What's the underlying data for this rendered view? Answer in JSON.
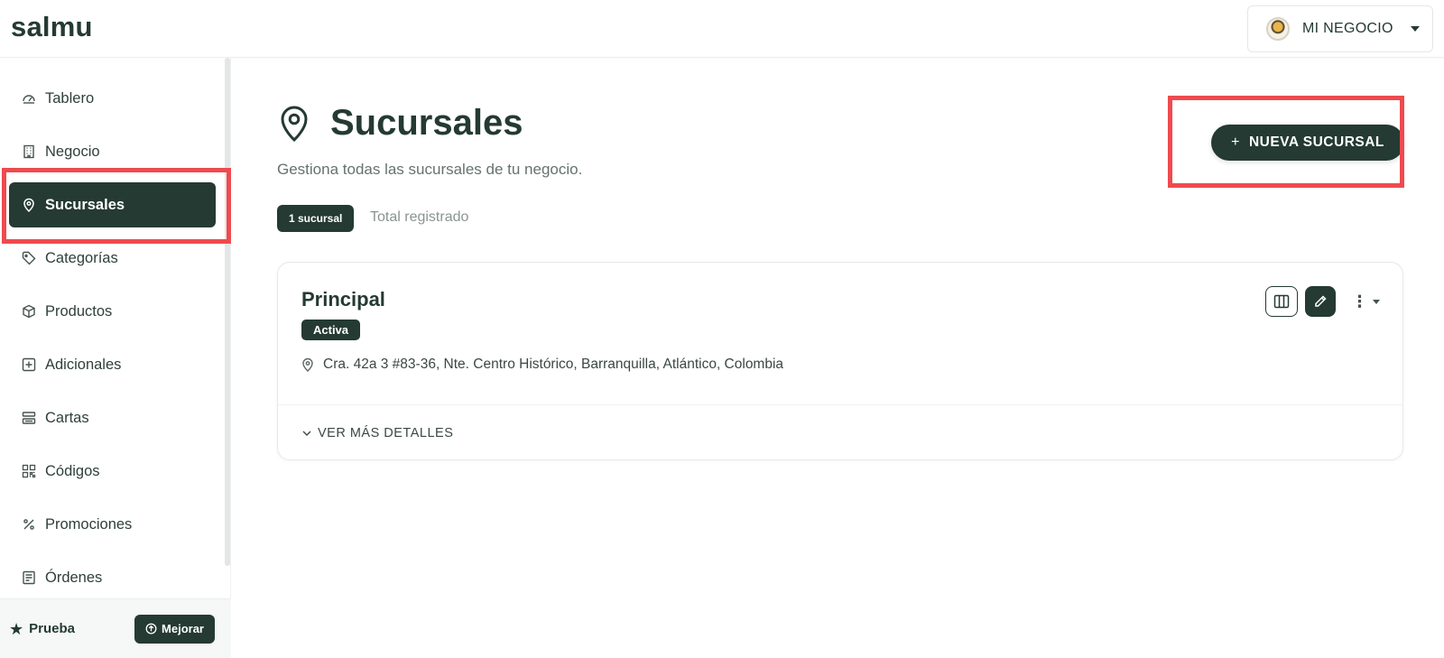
{
  "app": {
    "logo": "salmu"
  },
  "business_selector": {
    "name": "MI NEGOCIO",
    "avatar_icon": "business-logo"
  },
  "sidebar": {
    "items": [
      {
        "label": "Tablero",
        "icon": "dashboard-gauge-icon"
      },
      {
        "label": "Negocio",
        "icon": "building-icon"
      },
      {
        "label": "Sucursales",
        "icon": "map-pin-icon",
        "active": true
      },
      {
        "label": "Categorías",
        "icon": "tag-icon"
      },
      {
        "label": "Productos",
        "icon": "box-icon"
      },
      {
        "label": "Adicionales",
        "icon": "plus-square-icon"
      },
      {
        "label": "Cartas",
        "icon": "menu-list-icon"
      },
      {
        "label": "Códigos",
        "icon": "qr-code-icon"
      },
      {
        "label": "Promociones",
        "icon": "percent-icon"
      },
      {
        "label": "Órdenes",
        "icon": "receipt-icon"
      }
    ],
    "footer": {
      "plan": "Prueba",
      "upgrade_label": "Mejorar"
    }
  },
  "main": {
    "title": "Sucursales",
    "subtitle": "Gestiona todas las sucursales de tu negocio.",
    "count_badge": "1 sucursal",
    "count_label": "Total registrado",
    "new_button": {
      "icon": "+",
      "label": "NUEVA SUCURSAL"
    },
    "branches": [
      {
        "name": "Principal",
        "status": "Activa",
        "address": "Cra. 42a 3 #83-36, Nte. Centro Histórico, Barranquilla, Atlántico, Colombia",
        "details_label": "VER MÁS DETALLES"
      }
    ]
  },
  "colors": {
    "primary": "#243a33",
    "highlight": "#ef4a4f",
    "muted_text": "#66726e"
  }
}
